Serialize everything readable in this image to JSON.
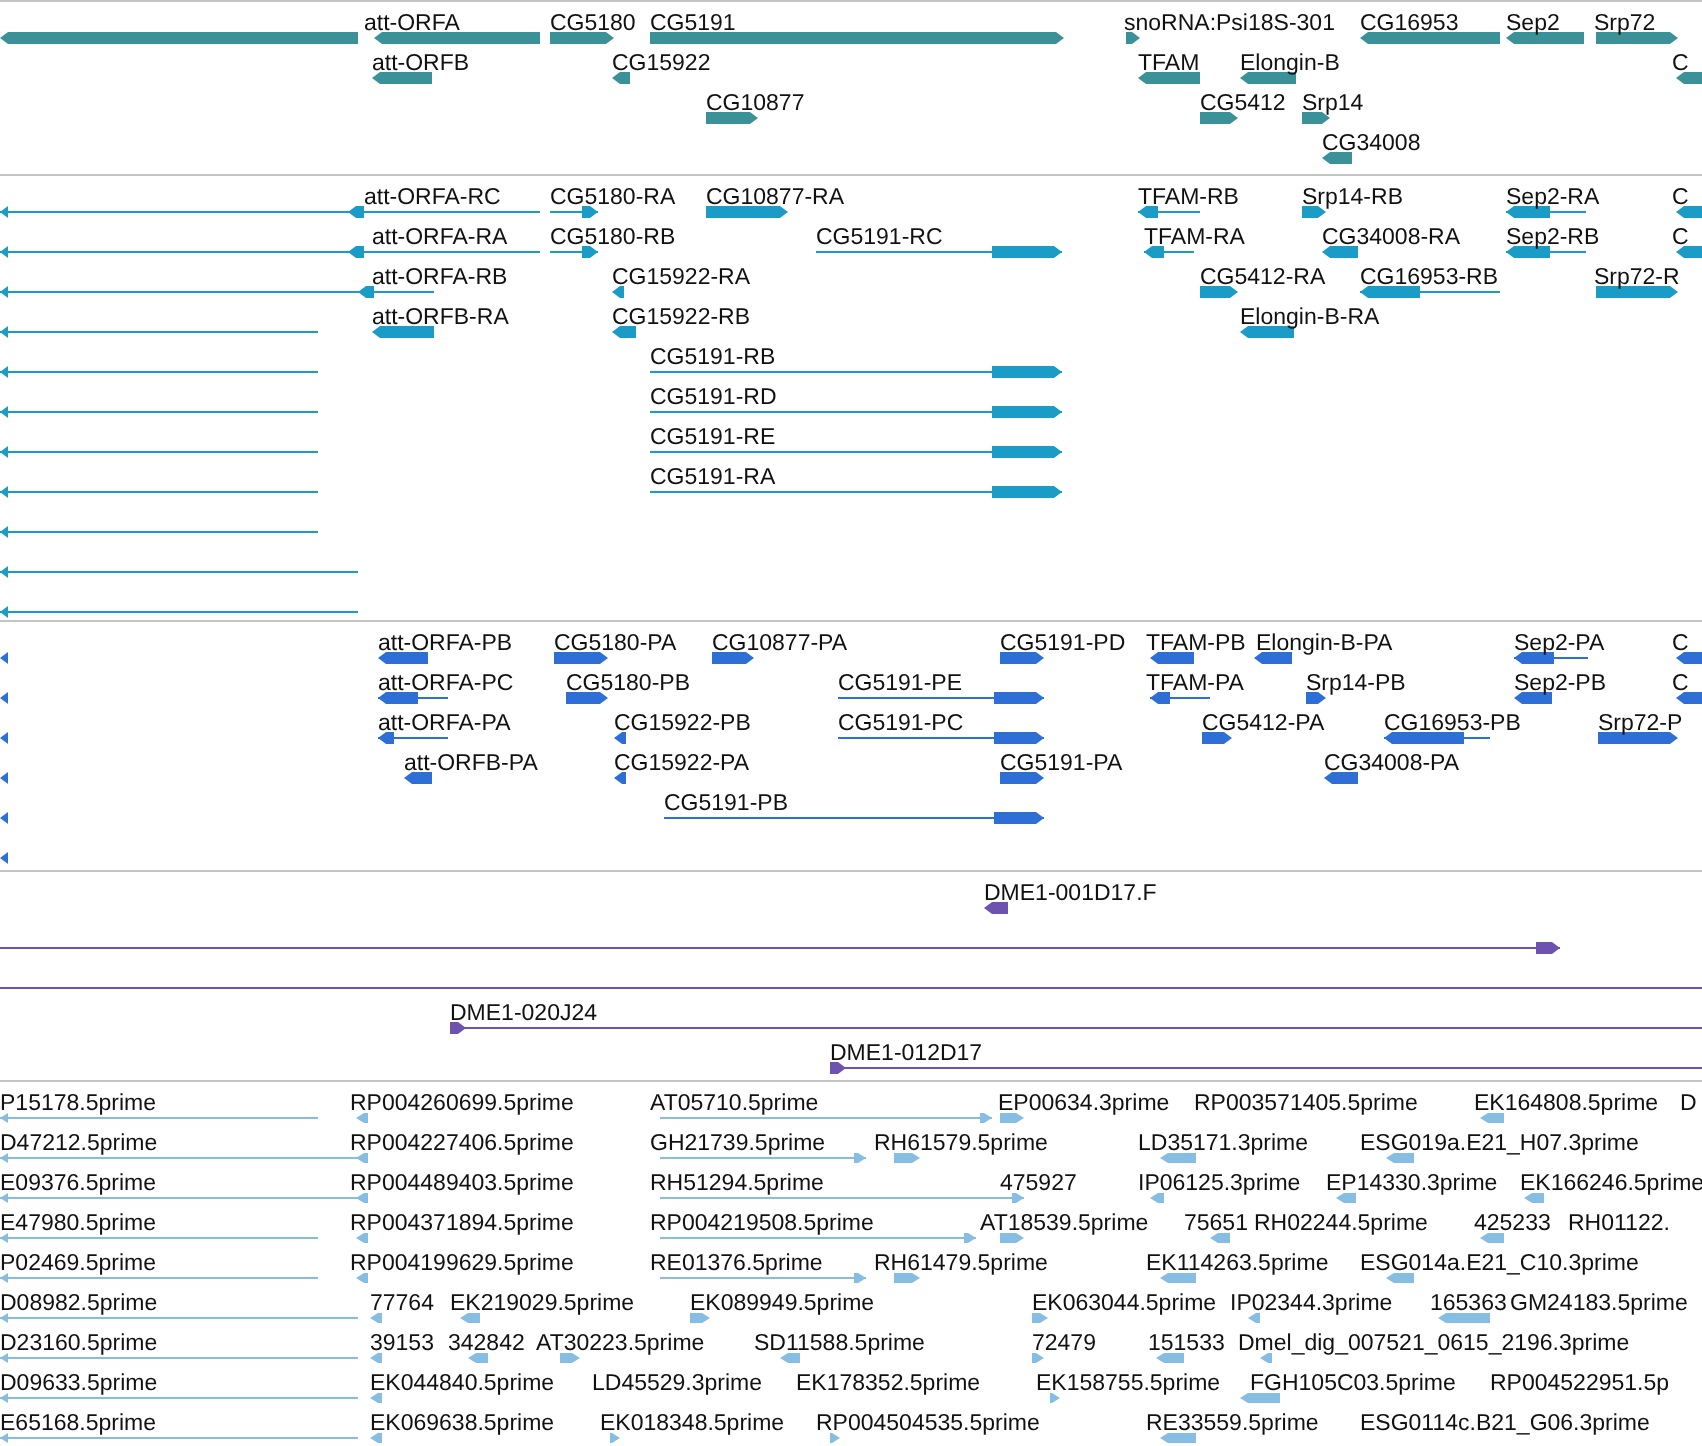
{
  "tracks": [
    {
      "kind": "gene",
      "color": "#3a9298",
      "features": [
        {
          "label": "att-ORFA"
        },
        {
          "label": "CG5180"
        },
        {
          "label": "CG5191"
        },
        {
          "label": "snoRNA:Psi18S-301"
        },
        {
          "label": "CG16953"
        },
        {
          "label": "Sep2"
        },
        {
          "label": "Srp72"
        },
        {
          "label": "att-ORFB"
        },
        {
          "label": "CG15922"
        },
        {
          "label": "TFAM"
        },
        {
          "label": "Elongin-B"
        },
        {
          "label": "C"
        },
        {
          "label": "CG10877"
        },
        {
          "label": "CG5412"
        },
        {
          "label": "Srp14"
        },
        {
          "label": "CG34008"
        }
      ]
    },
    {
      "kind": "transcript",
      "color": "#1a9cc6",
      "features": [
        {
          "label": "att-ORFA-RC"
        },
        {
          "label": "CG5180-RA"
        },
        {
          "label": "CG10877-RA"
        },
        {
          "label": "TFAM-RB"
        },
        {
          "label": "Srp14-RB"
        },
        {
          "label": "Sep2-RA"
        },
        {
          "label": "C"
        },
        {
          "label": "att-ORFA-RA"
        },
        {
          "label": "CG5180-RB"
        },
        {
          "label": "CG5191-RC"
        },
        {
          "label": "TFAM-RA"
        },
        {
          "label": "CG34008-RA"
        },
        {
          "label": "Sep2-RB"
        },
        {
          "label": "C"
        },
        {
          "label": "att-ORFA-RB"
        },
        {
          "label": "CG15922-RA"
        },
        {
          "label": "CG5412-RA"
        },
        {
          "label": "CG16953-RB"
        },
        {
          "label": "Srp72-R"
        },
        {
          "label": "att-ORFB-RA"
        },
        {
          "label": "CG15922-RB"
        },
        {
          "label": "Elongin-B-RA"
        },
        {
          "label": "CG5191-RB"
        },
        {
          "label": "CG5191-RD"
        },
        {
          "label": "CG5191-RE"
        },
        {
          "label": "CG5191-RA"
        }
      ]
    },
    {
      "kind": "transcript",
      "color": "#2d6fd6",
      "features": [
        {
          "label": "att-ORFA-PB"
        },
        {
          "label": "CG5180-PA"
        },
        {
          "label": "CG10877-PA"
        },
        {
          "label": "CG5191-PD"
        },
        {
          "label": "TFAM-PB"
        },
        {
          "label": "Elongin-B-PA"
        },
        {
          "label": "Sep2-PA"
        },
        {
          "label": "C"
        },
        {
          "label": "att-ORFA-PC"
        },
        {
          "label": "CG5180-PB"
        },
        {
          "label": "CG5191-PE"
        },
        {
          "label": "TFAM-PA"
        },
        {
          "label": "Srp14-PB"
        },
        {
          "label": "Sep2-PB"
        },
        {
          "label": "C"
        },
        {
          "label": "att-ORFA-PA"
        },
        {
          "label": "CG15922-PB"
        },
        {
          "label": "CG5191-PC"
        },
        {
          "label": "CG5412-PA"
        },
        {
          "label": "CG16953-PB"
        },
        {
          "label": "Srp72-P"
        },
        {
          "label": "att-ORFB-PA"
        },
        {
          "label": "CG15922-PA"
        },
        {
          "label": "CG5191-PA"
        },
        {
          "label": "CG34008-PA"
        },
        {
          "label": "CG5191-PB"
        }
      ]
    },
    {
      "kind": "clone",
      "color": "#6e52b0",
      "features": [
        {
          "label": "DME1-001D17.F"
        },
        {
          "label": "DME1-020J24"
        },
        {
          "label": "DME1-012D17"
        }
      ]
    },
    {
      "kind": "read",
      "color": "#86bde2",
      "features": [
        {
          "label": "P15178.5prime"
        },
        {
          "label": "RP004260699.5prime"
        },
        {
          "label": "AT05710.5prime"
        },
        {
          "label": "EP00634.3prime"
        },
        {
          "label": "RP003571405.5prime"
        },
        {
          "label": "EK164808.5prime"
        },
        {
          "label": "D"
        },
        {
          "label": "D47212.5prime"
        },
        {
          "label": "RP004227406.5prime"
        },
        {
          "label": "GH21739.5prime"
        },
        {
          "label": "RH61579.5prime"
        },
        {
          "label": "LD35171.3prime"
        },
        {
          "label": "ESG019a.E21_H07.3prime"
        },
        {
          "label": "E09376.5prime"
        },
        {
          "label": "RP004489403.5prime"
        },
        {
          "label": "RH51294.5prime"
        },
        {
          "label": "475927"
        },
        {
          "label": "IP06125.3prime"
        },
        {
          "label": "EP14330.3prime"
        },
        {
          "label": "EK166246.5prime"
        },
        {
          "label": "E47980.5prime"
        },
        {
          "label": "RP004371894.5prime"
        },
        {
          "label": "RP004219508.5prime"
        },
        {
          "label": "AT18539.5prime"
        },
        {
          "label": "75651"
        },
        {
          "label": "RH02244.5prime"
        },
        {
          "label": "425233"
        },
        {
          "label": "RH01122."
        },
        {
          "label": "P02469.5prime"
        },
        {
          "label": "RP004199629.5prime"
        },
        {
          "label": "RE01376.5prime"
        },
        {
          "label": "RH61479.5prime"
        },
        {
          "label": "EK114263.5prime"
        },
        {
          "label": "ESG014a.E21_C10.3prime"
        },
        {
          "label": "D08982.5prime"
        },
        {
          "label": "77764"
        },
        {
          "label": "EK219029.5prime"
        },
        {
          "label": "EK089949.5prime"
        },
        {
          "label": "EK063044.5prime"
        },
        {
          "label": "IP02344.3prime"
        },
        {
          "label": "165363"
        },
        {
          "label": "GM24183.5prime"
        },
        {
          "label": "D23160.5prime"
        },
        {
          "label": "39153"
        },
        {
          "label": "342842"
        },
        {
          "label": "AT30223.5prime"
        },
        {
          "label": "SD11588.5prime"
        },
        {
          "label": "72479"
        },
        {
          "label": "151533"
        },
        {
          "label": "Dmel_dig_007521_0615_2196.3prime"
        },
        {
          "label": "D09633.5prime"
        },
        {
          "label": "EK044840.5prime"
        },
        {
          "label": "LD45529.3prime"
        },
        {
          "label": "EK178352.5prime"
        },
        {
          "label": "EK158755.5prime"
        },
        {
          "label": "FGH105C03.5prime"
        },
        {
          "label": "RP004522951.5p"
        },
        {
          "label": "E65168.5prime"
        },
        {
          "label": "EK069638.5prime"
        },
        {
          "label": "EK018348.5prime"
        },
        {
          "label": "RP004504535.5prime"
        },
        {
          "label": "RE33559.5prime"
        },
        {
          "label": "ESG0114c.B21_G06.3prime"
        }
      ]
    }
  ]
}
